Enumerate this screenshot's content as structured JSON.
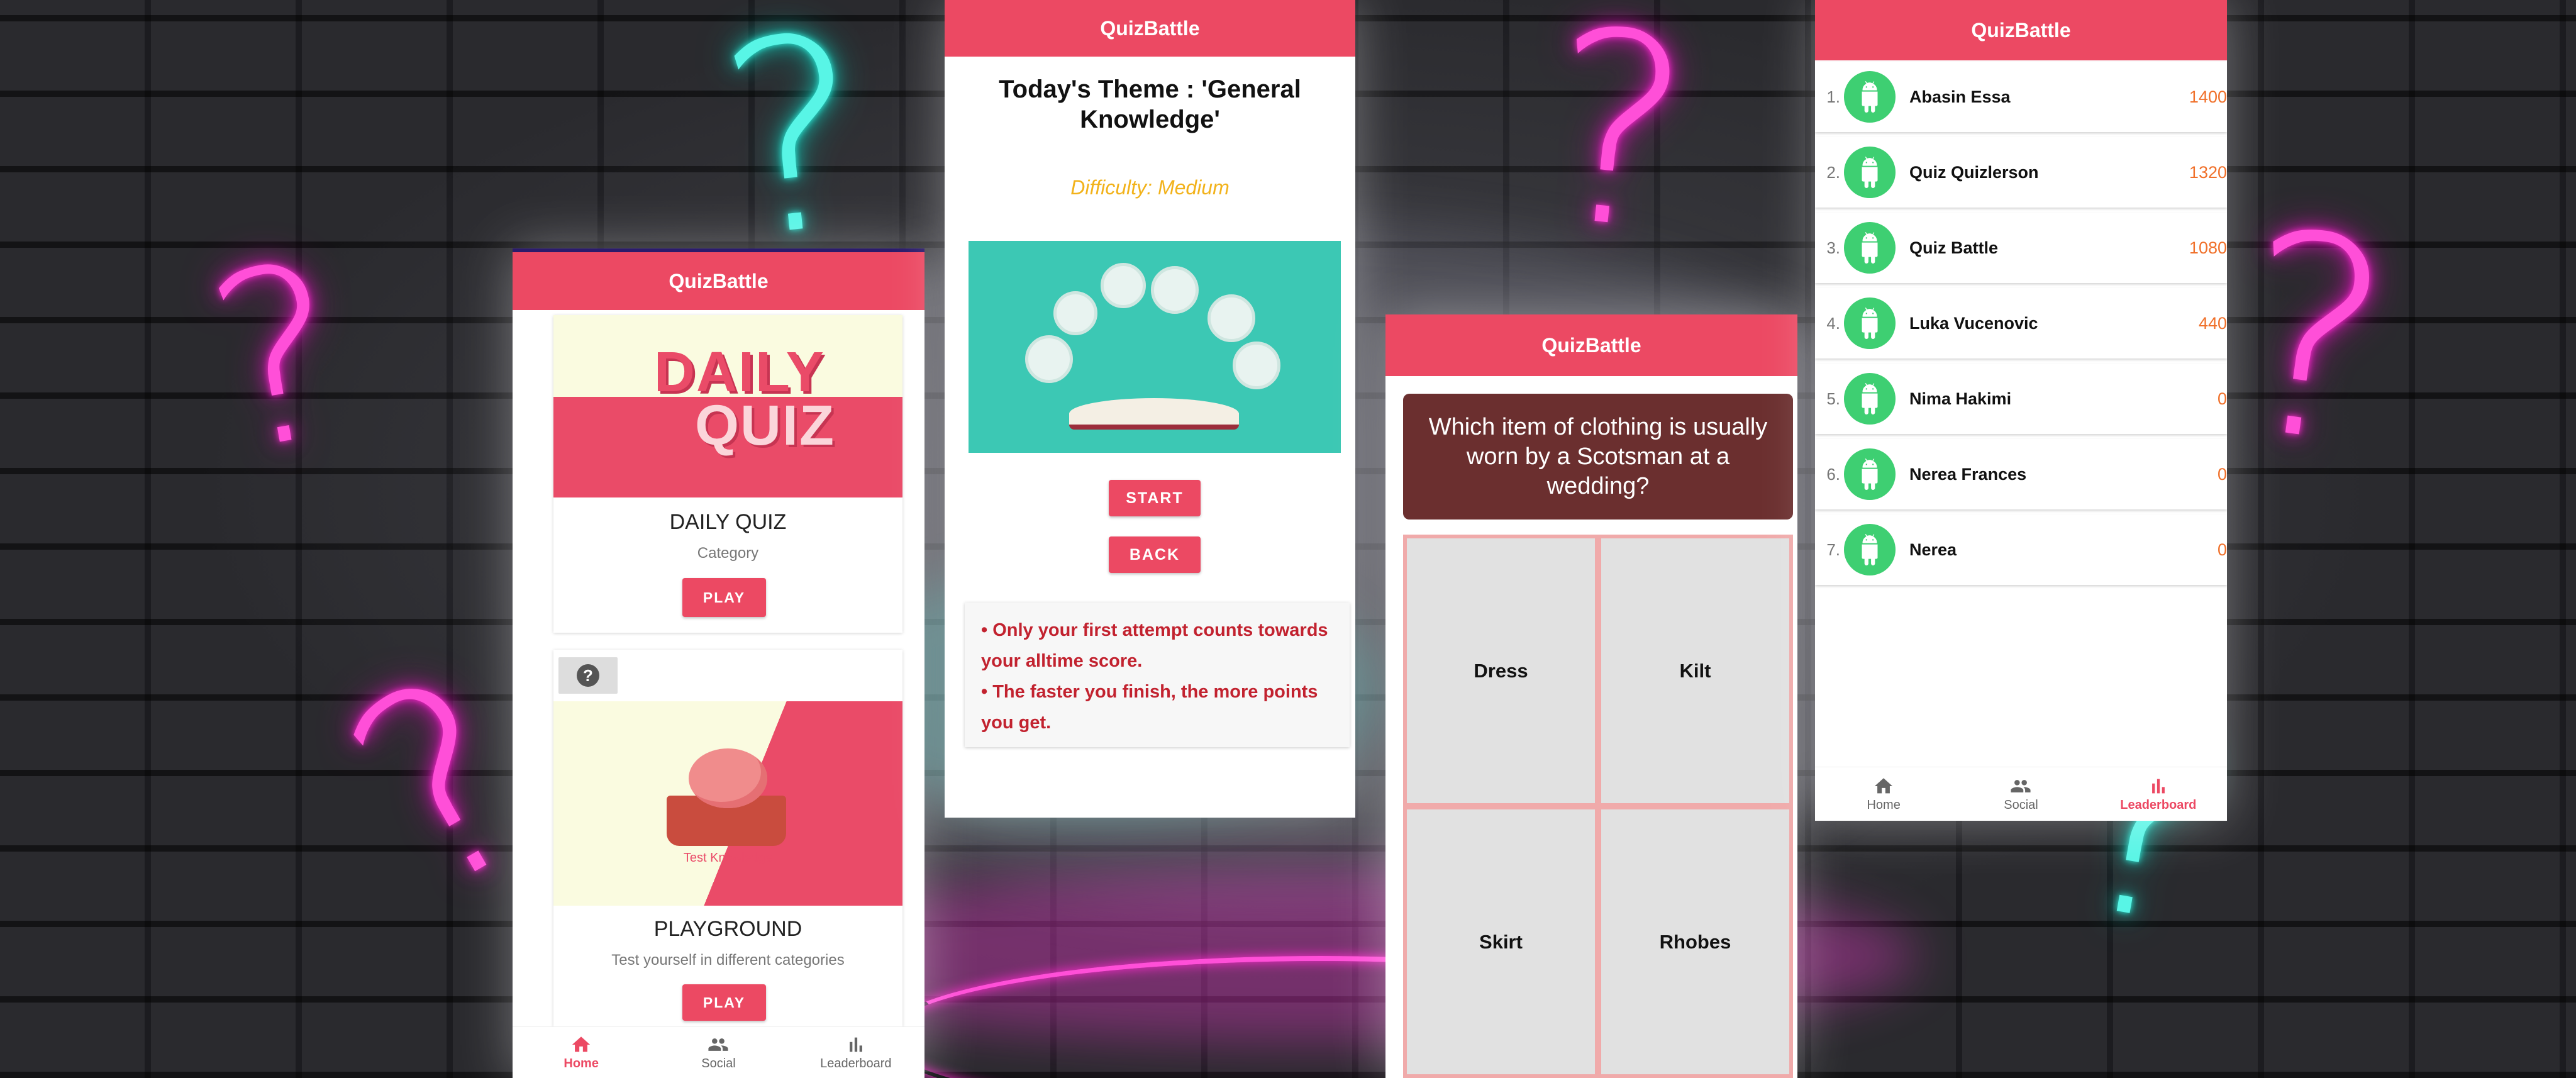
{
  "colors": {
    "brand": "#ec4963",
    "question_bg": "#6b2f2f",
    "difficulty": "#f2b21a",
    "rules_text": "#c2222f",
    "score": "#f0702a",
    "avatar": "#3ecf72"
  },
  "app_title": "QuizBattle",
  "home": {
    "daily_banner": {
      "line1": "DAILY",
      "line2": "QUIZ"
    },
    "cards": [
      {
        "title": "DAILY QUIZ",
        "subtitle": "Category",
        "button": "PLAY"
      },
      {
        "title": "PLAYGROUND",
        "subtitle": "Test yourself in different categories",
        "button": "PLAY",
        "image_caption": "Test Knowledge",
        "help_icon": "?"
      }
    ]
  },
  "nav": {
    "home": "Home",
    "social": "Social",
    "leaderboard": "Leaderboard"
  },
  "theme_screen": {
    "theme": "Today's  Theme : 'General Knowledge'",
    "difficulty": "Difficulty: Medium",
    "start": "START",
    "back": "BACK",
    "rules": [
      "• Only your first attempt counts towards your alltime score.",
      "• The faster you finish, the more points you get."
    ]
  },
  "question_screen": {
    "question": "Which item of clothing is usually worn by a Scotsman at a wedding?",
    "answers": [
      "Dress",
      "Kilt",
      "Skirt",
      "Rhobes"
    ]
  },
  "leaderboard": [
    {
      "rank": "1.",
      "name": "Abasin Essa",
      "score": "1400"
    },
    {
      "rank": "2.",
      "name": "Quiz Quizlerson",
      "score": "1320"
    },
    {
      "rank": "3.",
      "name": "Quiz Battle",
      "score": "1080"
    },
    {
      "rank": "4.",
      "name": "Luka Vucenovic",
      "score": "440"
    },
    {
      "rank": "5.",
      "name": "Nima Hakimi",
      "score": "0"
    },
    {
      "rank": "6.",
      "name": "Nerea Frances",
      "score": "0"
    },
    {
      "rank": "7.",
      "name": "Nerea",
      "score": "0"
    }
  ]
}
